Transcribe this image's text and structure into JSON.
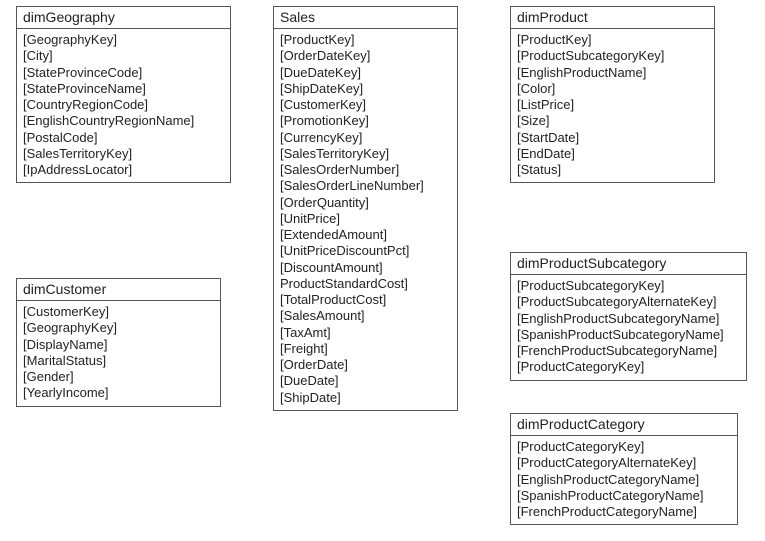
{
  "tables": {
    "dimGeography": {
      "title": "dimGeography",
      "fields": [
        "[GeographyKey]",
        "[City]",
        "[StateProvinceCode]",
        "[StateProvinceName]",
        "[CountryRegionCode]",
        "[EnglishCountryRegionName]",
        "[PostalCode]",
        "[SalesTerritoryKey]",
        "[IpAddressLocator]"
      ]
    },
    "dimCustomer": {
      "title": "dimCustomer",
      "fields": [
        "[CustomerKey]",
        "[GeographyKey]",
        "[DisplayName]",
        "[MaritalStatus]",
        "[Gender]",
        "[YearlyIncome]"
      ]
    },
    "sales": {
      "title": "Sales",
      "fields": [
        "[ProductKey]",
        "[OrderDateKey]",
        "[DueDateKey]",
        "[ShipDateKey]",
        "[CustomerKey]",
        "[PromotionKey]",
        "[CurrencyKey]",
        "[SalesTerritoryKey]",
        "[SalesOrderNumber]",
        "[SalesOrderLineNumber]",
        "[OrderQuantity]",
        "[UnitPrice]",
        "[ExtendedAmount]",
        "[UnitPriceDiscountPct]",
        "[DiscountAmount]",
        "ProductStandardCost]",
        "[TotalProductCost]",
        "[SalesAmount]",
        "[TaxAmt]",
        "[Freight]",
        "[OrderDate]",
        "[DueDate]",
        "[ShipDate]"
      ]
    },
    "dimProduct": {
      "title": "dimProduct",
      "fields": [
        "[ProductKey]",
        "[ProductSubcategoryKey]",
        "[EnglishProductName]",
        "[Color]",
        "[ListPrice]",
        "[Size]",
        "[StartDate]",
        "[EndDate]",
        "[Status]"
      ]
    },
    "dimProductSubcategory": {
      "title": "dimProductSubcategory",
      "fields": [
        "[ProductSubcategoryKey]",
        "[ProductSubcategoryAlternateKey]",
        "[EnglishProductSubcategoryName]",
        "[SpanishProductSubcategoryName]",
        "[FrenchProductSubcategoryName]",
        "[ProductCategoryKey]"
      ]
    },
    "dimProductCategory": {
      "title": "dimProductCategory",
      "fields": [
        "[ProductCategoryKey]",
        "[ProductCategoryAlternateKey]",
        "[EnglishProductCategoryName]",
        "[SpanishProductCategoryName]",
        "[FrenchProductCategoryName]"
      ]
    }
  }
}
